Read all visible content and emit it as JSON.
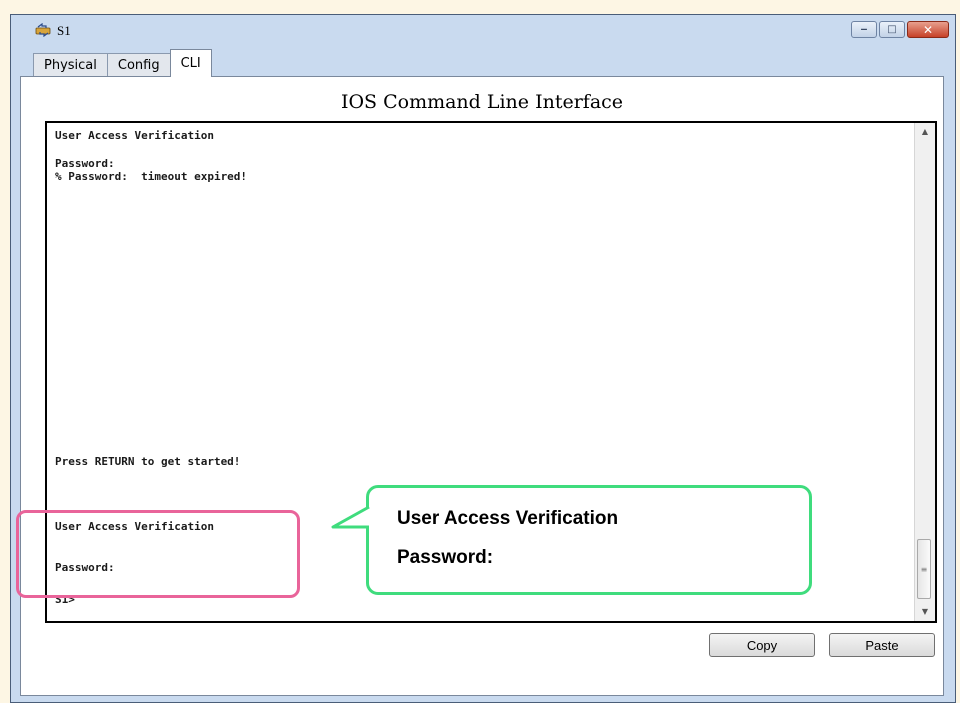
{
  "window": {
    "title": "S1",
    "icons": {
      "app": "switch-icon",
      "minimize": "minimize-icon",
      "maximize": "maximize-icon",
      "close": "close-icon"
    }
  },
  "tabs": [
    {
      "label": "Physical",
      "active": false
    },
    {
      "label": "Config",
      "active": false
    },
    {
      "label": "CLI",
      "active": true
    }
  ],
  "main": {
    "heading": "IOS Command Line Interface",
    "terminal_lines": [
      "User Access Verification",
      "",
      "Password:",
      "% Password:  timeout expired!",
      "Press RETURN to get started!",
      "User Access Verification",
      "Password:",
      "S1>"
    ],
    "copy_label": "Copy",
    "paste_label": "Paste"
  },
  "annotation": {
    "callout_line1": "User Access Verification",
    "callout_line2": "Password:",
    "highlight_color": "#e9649a",
    "callout_color": "#3fdc7d"
  },
  "colors": {
    "window_chrome": "#c9daef",
    "close_button": "#c64128"
  }
}
